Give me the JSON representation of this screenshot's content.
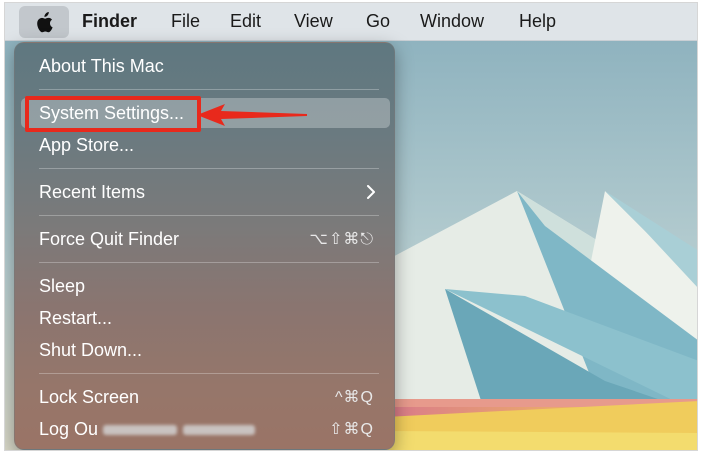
{
  "menu_bar": {
    "apple_icon": "apple-logo-icon",
    "items": [
      {
        "label": "Finder"
      },
      {
        "label": "File"
      },
      {
        "label": "Edit"
      },
      {
        "label": "View"
      },
      {
        "label": "Go"
      },
      {
        "label": "Window"
      },
      {
        "label": "Help"
      }
    ]
  },
  "apple_menu": {
    "about": "About This Mac",
    "system_settings": "System Settings...",
    "app_store": "App Store...",
    "recent_items": "Recent Items",
    "recent_items_icon": "chevron-right-icon",
    "force_quit": "Force Quit Finder",
    "force_quit_shortcut": "⌥⇧⌘⎋",
    "sleep": "Sleep",
    "restart": "Restart...",
    "shut_down": "Shut Down...",
    "lock_screen": "Lock Screen",
    "lock_screen_shortcut": "^⌘Q",
    "log_out_prefix": "Log Ou",
    "log_out_shortcut": "⇧⌘Q"
  },
  "annotation": {
    "color": "#e8291c",
    "arrow_icon": "red-arrow-icon"
  }
}
